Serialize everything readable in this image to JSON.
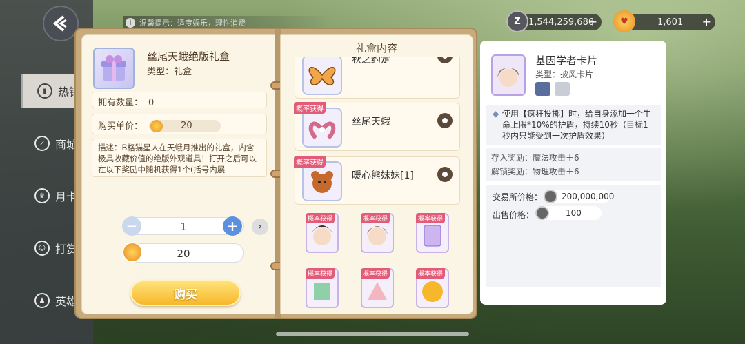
{
  "notice": {
    "icon": "info-icon",
    "text": "温馨提示：适度娱乐，理性消费"
  },
  "currency": {
    "coins": "1,544,259,686",
    "gems": "1,601"
  },
  "sidebar": {
    "items": [
      {
        "label": "热销",
        "icon": "chart-icon"
      },
      {
        "label": "商城",
        "icon": "shop-icon"
      },
      {
        "label": "月卡",
        "icon": "crown-icon"
      },
      {
        "label": "打赏",
        "icon": "gift-icon"
      },
      {
        "label": "英雄",
        "icon": "hero-icon"
      }
    ]
  },
  "item": {
    "name": "丝尾天蛾绝版礼盒",
    "type": "类型：礼盒",
    "owned_label": "拥有数量：",
    "owned_value": "0",
    "price_label": "购买单价：",
    "price_value": "20",
    "desc": "描述：B格猫星人在天蛾月推出的礼盒，内含极具收藏价值的绝版外观道具！打开之后可以在以下奖励中随机获得1个(括号内展",
    "qty": "1",
    "total": "20",
    "buy_label": "购买"
  },
  "contents": {
    "title": "礼盒内容",
    "tag": "概率获得",
    "rows": [
      {
        "name": "秋之约定"
      },
      {
        "name": "丝尾天蛾"
      },
      {
        "name": "暖心熊妹妹[1]"
      }
    ]
  },
  "detail": {
    "name": "基因学者卡片",
    "type": "类型：披风卡片",
    "effect": "使用【疯狂投掷】时，给自身添加一个生命上限*10%的护盾，持续10秒（目标1秒内只能受到一次护盾效果）",
    "store_bonus": "存入奖励：魔法攻击＋6",
    "unlock_bonus": "解锁奖励：物理攻击＋6",
    "market_label": "交易所价格：",
    "market_price": "200,000,000",
    "sell_label": "出售价格：",
    "sell_price": "100"
  }
}
